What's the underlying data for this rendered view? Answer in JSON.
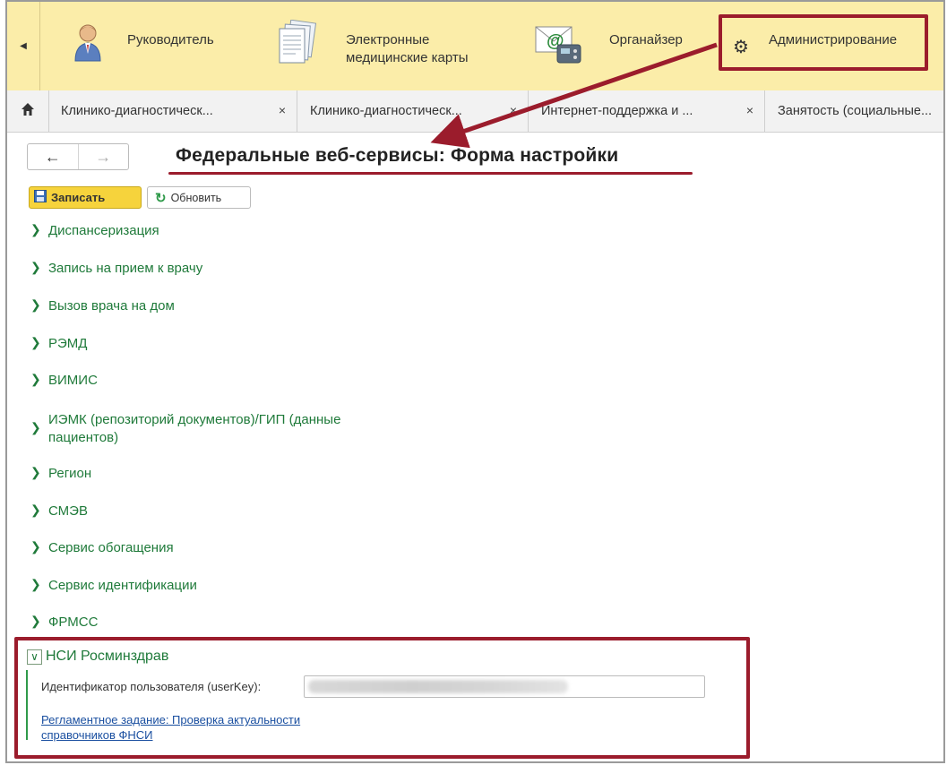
{
  "sections": [
    {
      "key": "manager",
      "label": "Руководитель",
      "icon": "user-icon"
    },
    {
      "key": "emc",
      "label": "Электронные медицинские карты",
      "icon": "documents-icon"
    },
    {
      "key": "organizer",
      "label": "Органайзер",
      "icon": "mail-phone-icon"
    },
    {
      "key": "admin",
      "label": "Администрирование",
      "icon": "gear-icon"
    }
  ],
  "tabs": [
    {
      "label": "Клинико-диагностическ...",
      "close": "×"
    },
    {
      "label": "Клинико-диагностическ...",
      "close": "×"
    },
    {
      "label": "Интернет-поддержка и ...",
      "close": "×"
    },
    {
      "label": "Занятость (социальные...",
      "close": ""
    }
  ],
  "nav": {
    "back": "←",
    "forward": "→"
  },
  "page": {
    "title": "Федеральные веб-сервисы: Форма настройки"
  },
  "toolbar": {
    "save_label": "Записать",
    "refresh_label": "Обновить"
  },
  "groups": [
    {
      "label": "Диспансеризация"
    },
    {
      "label": "Запись на прием к врачу"
    },
    {
      "label": "Вызов врача на дом"
    },
    {
      "label": "РЭМД"
    },
    {
      "label": "ВИМИС"
    },
    {
      "label": "ИЭМК (репозиторий документов)/ГИП (данные пациентов)"
    },
    {
      "label": "Регион"
    },
    {
      "label": "СМЭВ"
    },
    {
      "label": "Сервис обогащения"
    },
    {
      "label": "Сервис идентификации"
    },
    {
      "label": "ФРМСС"
    }
  ],
  "expanded": {
    "label": "НСИ Росминздрав",
    "userkey_label": "Идентификатор пользователя (userKey):",
    "job_link": "Регламентное задание: Проверка актуальности справочников ФНСИ"
  },
  "colors": {
    "accent": "#9b1c2c",
    "section_bar": "#fbeda9",
    "group_text": "#1f7a3a",
    "save_button": "#f6d33c",
    "link": "#1a4fa0"
  }
}
